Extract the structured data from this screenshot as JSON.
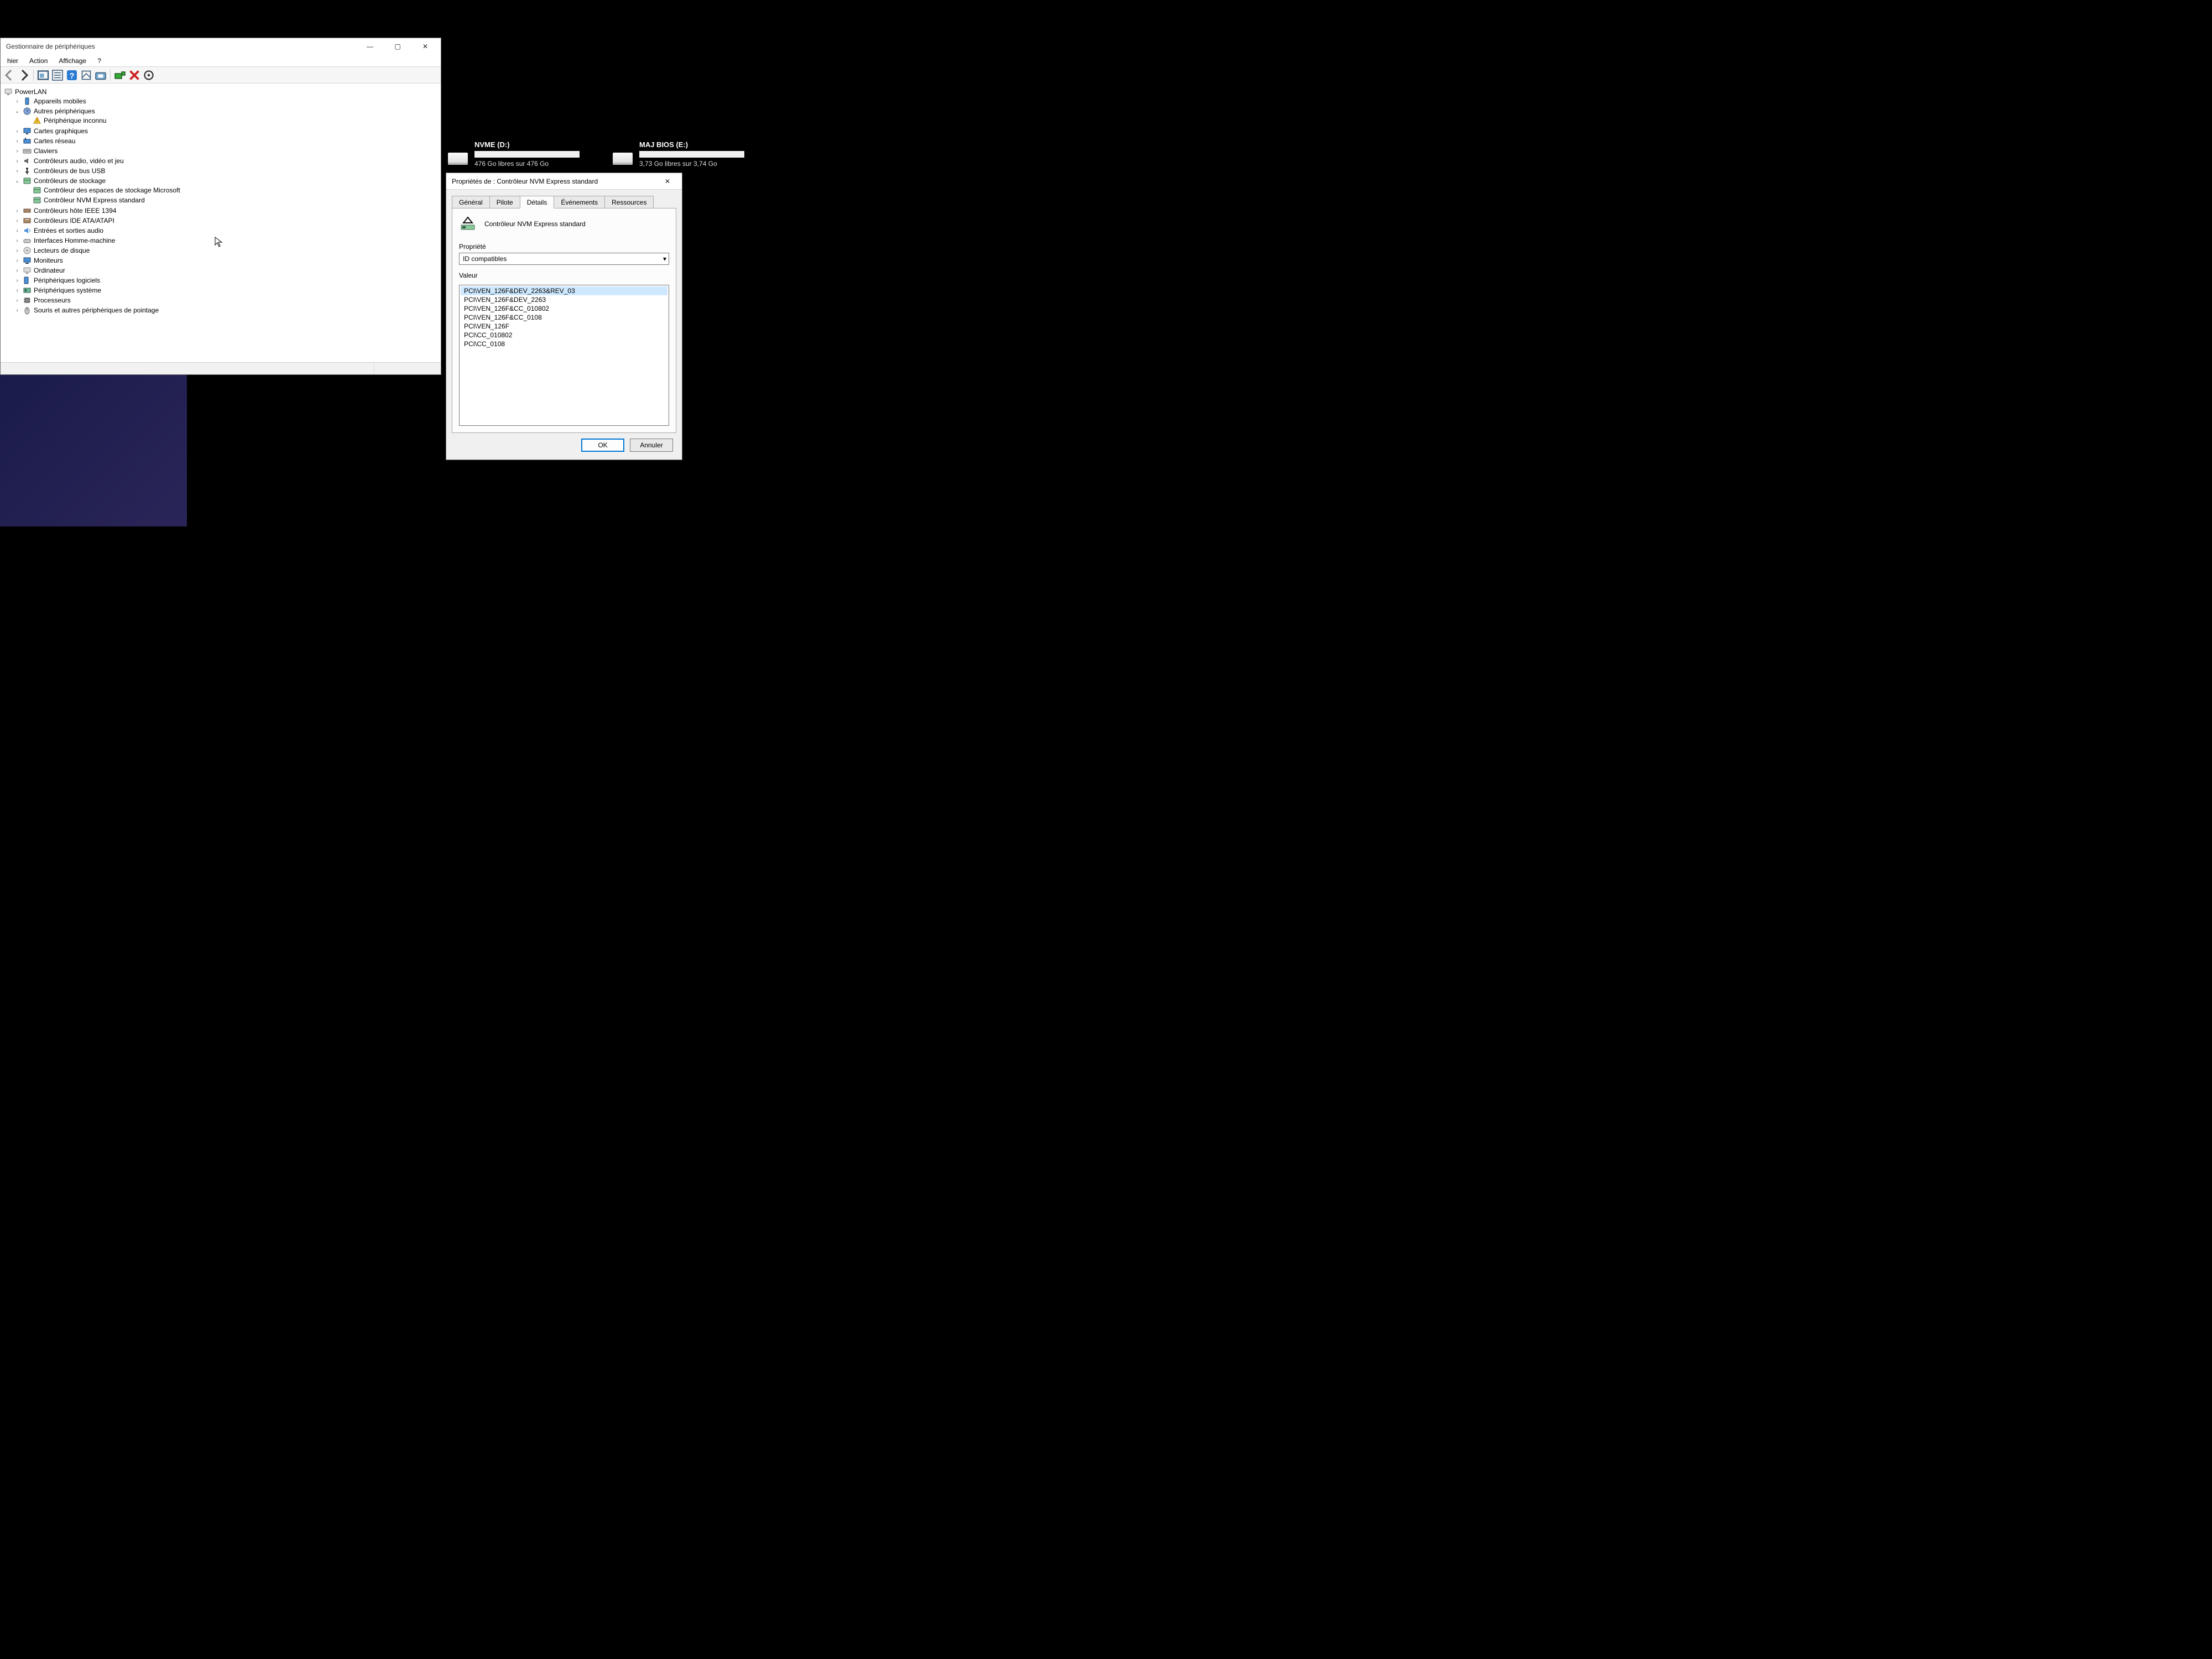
{
  "device_manager": {
    "title": "Gestionnaire de périphériques",
    "menu": [
      "hier",
      "Action",
      "Affichage",
      "?"
    ],
    "tree_root": "PowerLAN",
    "nodes": [
      {
        "twisty": ">",
        "icon": "mobile",
        "label": "Appareils mobiles"
      },
      {
        "twisty": "v",
        "icon": "other",
        "label": "Autres périphériques",
        "children": [
          {
            "icon": "warn",
            "label": "Périphérique inconnu"
          }
        ]
      },
      {
        "twisty": ">",
        "icon": "display",
        "label": "Cartes graphiques"
      },
      {
        "twisty": ">",
        "icon": "net",
        "label": "Cartes réseau"
      },
      {
        "twisty": ">",
        "icon": "keyboard",
        "label": "Claviers"
      },
      {
        "twisty": ">",
        "icon": "sound",
        "label": "Contrôleurs audio, vidéo et jeu"
      },
      {
        "twisty": ">",
        "icon": "usb",
        "label": "Contrôleurs de bus USB"
      },
      {
        "twisty": "v",
        "icon": "storage",
        "label": "Contrôleurs de stockage",
        "children": [
          {
            "icon": "storage",
            "label": "Contrôleur des espaces de stockage Microsoft"
          },
          {
            "icon": "storage",
            "label": "Contrôleur NVM Express standard"
          }
        ]
      },
      {
        "twisty": ">",
        "icon": "port",
        "label": "Contrôleurs hôte IEEE 1394"
      },
      {
        "twisty": ">",
        "icon": "ide",
        "label": "Contrôleurs IDE ATA/ATAPI"
      },
      {
        "twisty": ">",
        "icon": "audio",
        "label": "Entrées et sorties audio"
      },
      {
        "twisty": ">",
        "icon": "hid",
        "label": "Interfaces Homme-machine"
      },
      {
        "twisty": ">",
        "icon": "optical",
        "label": "Lecteurs de disque"
      },
      {
        "twisty": ">",
        "icon": "monitor",
        "label": "Moniteurs"
      },
      {
        "twisty": ">",
        "icon": "computer",
        "label": "Ordinateur"
      },
      {
        "twisty": ">",
        "icon": "soft",
        "label": "Périphériques logiciels"
      },
      {
        "twisty": ">",
        "icon": "system",
        "label": "Périphériques système"
      },
      {
        "twisty": ">",
        "icon": "cpu",
        "label": "Processeurs"
      },
      {
        "twisty": ">",
        "icon": "mouse",
        "label": "Souris et autres périphériques de pointage"
      }
    ]
  },
  "drives": [
    {
      "title": "NVME (D:)",
      "sub": "476 Go libres sur 476 Go"
    },
    {
      "title": "MAJ BIOS (E:)",
      "sub": "3,73 Go libres sur 3,74 Go"
    }
  ],
  "props": {
    "title": "Propriétés de : Contrôleur NVM Express standard",
    "tabs": [
      "Général",
      "Pilote",
      "Détails",
      "Événements",
      "Ressources"
    ],
    "active_tab": 2,
    "device_name": "Contrôleur NVM Express standard",
    "property_label": "Propriété",
    "property_value": "ID compatibles",
    "value_label": "Valeur",
    "values": [
      "PCI\\VEN_126F&DEV_2263&REV_03",
      "PCI\\VEN_126F&DEV_2263",
      "PCI\\VEN_126F&CC_010802",
      "PCI\\VEN_126F&CC_0108",
      "PCI\\VEN_126F",
      "PCI\\CC_010802",
      "PCI\\CC_0108"
    ],
    "ok": "OK",
    "cancel": "Annuler"
  }
}
